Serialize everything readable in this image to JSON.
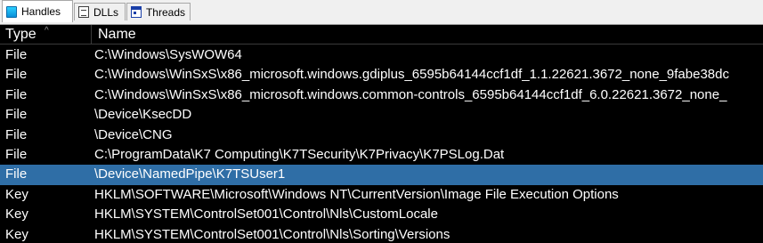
{
  "tabs": [
    {
      "label": "Handles",
      "icon": "handles-icon",
      "active": true
    },
    {
      "label": "DLLs",
      "icon": "dll-icon",
      "active": false
    },
    {
      "label": "Threads",
      "icon": "threads-icon",
      "active": false
    }
  ],
  "table": {
    "columns": {
      "type": "Type",
      "name": "Name",
      "sort_indicator": "^"
    },
    "rows": [
      {
        "type": "File",
        "name": "C:\\Windows\\SysWOW64"
      },
      {
        "type": "File",
        "name": "C:\\Windows\\WinSxS\\x86_microsoft.windows.gdiplus_6595b64144ccf1df_1.1.22621.3672_none_9fabe38dc"
      },
      {
        "type": "File",
        "name": "C:\\Windows\\WinSxS\\x86_microsoft.windows.common-controls_6595b64144ccf1df_6.0.22621.3672_none_"
      },
      {
        "type": "File",
        "name": "\\Device\\KsecDD"
      },
      {
        "type": "File",
        "name": "\\Device\\CNG"
      },
      {
        "type": "File",
        "name": "C:\\ProgramData\\K7 Computing\\K7TSecurity\\K7Privacy\\K7PSLog.Dat"
      },
      {
        "type": "File",
        "name": "\\Device\\NamedPipe\\K7TSUser1",
        "selected": true
      },
      {
        "type": "Key",
        "name": "HKLM\\SOFTWARE\\Microsoft\\Windows NT\\CurrentVersion\\Image File Execution Options"
      },
      {
        "type": "Key",
        "name": "HKLM\\SYSTEM\\ControlSet001\\Control\\Nls\\CustomLocale"
      },
      {
        "type": "Key",
        "name": "HKLM\\SYSTEM\\ControlSet001\\Control\\Nls\\Sorting\\Versions"
      }
    ]
  },
  "colors": {
    "background": "#000000",
    "text": "#ffffff",
    "selection": "#2f6ea6",
    "tabstrip": "#f0f0f0"
  }
}
